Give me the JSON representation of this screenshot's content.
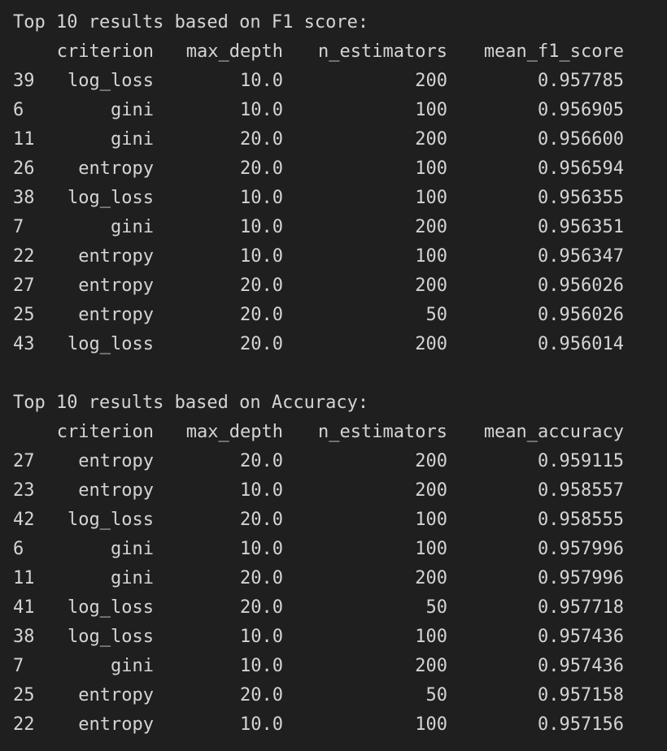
{
  "sections": [
    {
      "title": "Top 10 results based on F1 score:",
      "headers": [
        "",
        "criterion",
        "max_depth",
        "n_estimators",
        "mean_f1_score"
      ],
      "rows": [
        [
          "39",
          "log_loss",
          "10.0",
          "200",
          "0.957785"
        ],
        [
          "6",
          "gini",
          "10.0",
          "100",
          "0.956905"
        ],
        [
          "11",
          "gini",
          "20.0",
          "200",
          "0.956600"
        ],
        [
          "26",
          "entropy",
          "20.0",
          "100",
          "0.956594"
        ],
        [
          "38",
          "log_loss",
          "10.0",
          "100",
          "0.956355"
        ],
        [
          "7",
          "gini",
          "10.0",
          "200",
          "0.956351"
        ],
        [
          "22",
          "entropy",
          "10.0",
          "100",
          "0.956347"
        ],
        [
          "27",
          "entropy",
          "20.0",
          "200",
          "0.956026"
        ],
        [
          "25",
          "entropy",
          "20.0",
          "50",
          "0.956026"
        ],
        [
          "43",
          "log_loss",
          "20.0",
          "200",
          "0.956014"
        ]
      ]
    },
    {
      "title": "Top 10 results based on Accuracy:",
      "headers": [
        "",
        "criterion",
        "max_depth",
        "n_estimators",
        "mean_accuracy"
      ],
      "rows": [
        [
          "27",
          "entropy",
          "20.0",
          "200",
          "0.959115"
        ],
        [
          "23",
          "entropy",
          "10.0",
          "200",
          "0.958557"
        ],
        [
          "42",
          "log_loss",
          "20.0",
          "100",
          "0.958555"
        ],
        [
          "6",
          "gini",
          "10.0",
          "100",
          "0.957996"
        ],
        [
          "11",
          "gini",
          "20.0",
          "200",
          "0.957996"
        ],
        [
          "41",
          "log_loss",
          "20.0",
          "50",
          "0.957718"
        ],
        [
          "38",
          "log_loss",
          "10.0",
          "100",
          "0.957436"
        ],
        [
          "7",
          "gini",
          "10.0",
          "200",
          "0.957436"
        ],
        [
          "25",
          "entropy",
          "20.0",
          "50",
          "0.957158"
        ],
        [
          "22",
          "entropy",
          "10.0",
          "100",
          "0.957156"
        ]
      ]
    }
  ],
  "colors": {
    "background": "#1f1f1f",
    "text": "#d4d4d4"
  }
}
